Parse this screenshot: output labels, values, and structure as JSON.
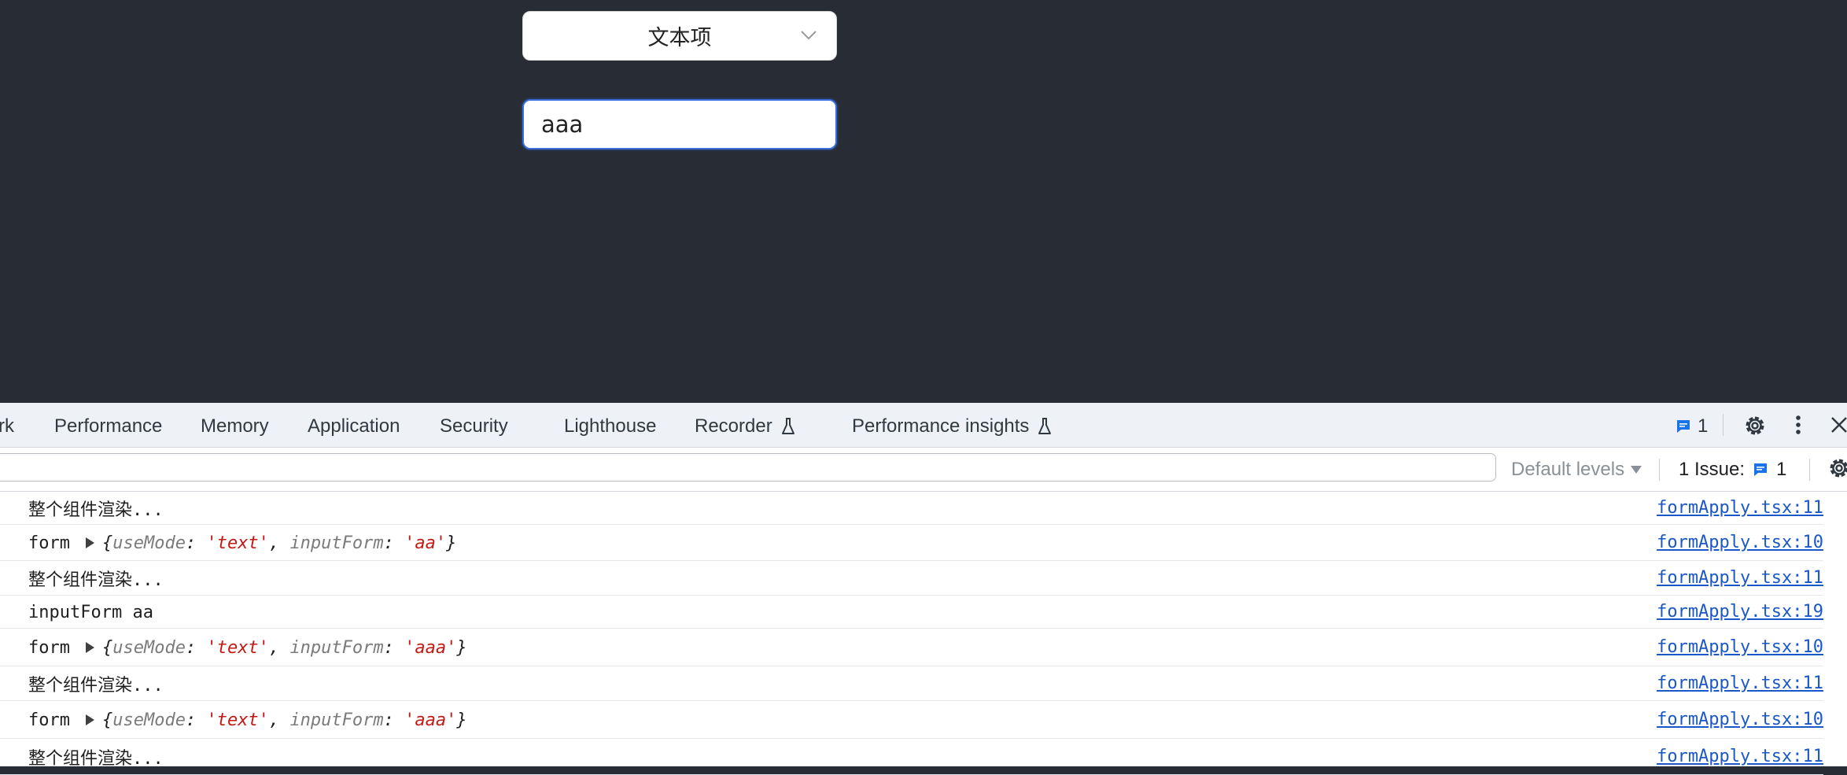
{
  "page": {
    "select": {
      "value": "文本项",
      "icon": "chevron-down-icon"
    },
    "input": {
      "value": "aaa"
    }
  },
  "devtools": {
    "tabs": [
      "rk",
      "Performance",
      "Memory",
      "Application",
      "Security",
      "Lighthouse",
      "Recorder",
      "Performance insights"
    ],
    "message_badge": "1",
    "filter": {
      "levels_label": "Default levels",
      "issues_label": "1 Issue:",
      "issues_count": "1"
    },
    "console": [
      {
        "kind": "text",
        "text": "整个组件渲染...",
        "source": "formApply.tsx:11"
      },
      {
        "kind": "obj",
        "prefix": "form",
        "useMode": "'text'",
        "inputForm": "'aa'",
        "source": "formApply.tsx:10"
      },
      {
        "kind": "text",
        "text": "整个组件渲染...",
        "source": "formApply.tsx:11"
      },
      {
        "kind": "text",
        "text": "inputForm aa",
        "source": "formApply.tsx:19"
      },
      {
        "kind": "obj",
        "prefix": "form",
        "useMode": "'text'",
        "inputForm": "'aaa'",
        "source": "formApply.tsx:10"
      },
      {
        "kind": "text",
        "text": "整个组件渲染...",
        "source": "formApply.tsx:11"
      },
      {
        "kind": "obj",
        "prefix": "form",
        "useMode": "'text'",
        "inputForm": "'aaa'",
        "source": "formApply.tsx:10"
      },
      {
        "kind": "text",
        "text": "整个组件渲染...",
        "source": "formApply.tsx:11"
      }
    ],
    "object_keys": {
      "useMode": "useMode",
      "inputForm": "inputForm"
    }
  }
}
